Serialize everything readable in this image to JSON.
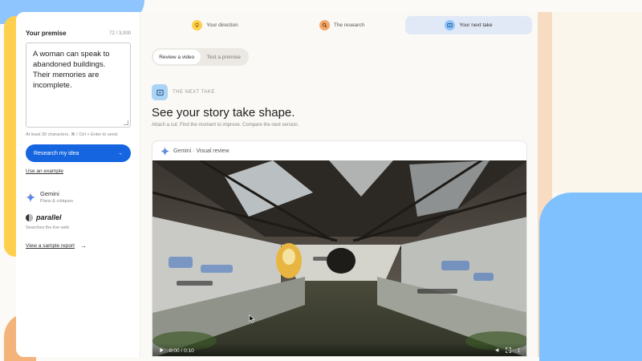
{
  "sidebar": {
    "premise_label": "Your premise",
    "premise_count": "72 / 3,000",
    "premise_text": "A woman can speak to abandoned buildings. Their memories are incomplete.",
    "hint": "At least 30 characters. ⌘ / Ctrl + Enter to send.",
    "research_button": "Research my idea",
    "research_arrow": "→",
    "example_link": "Use an example",
    "gemini_name": "Gemini",
    "gemini_sub": "Plans & critiques",
    "parallel_name": "parallel",
    "parallel_sub": "Searches the live web",
    "sample_link": "View a sample report",
    "sample_arrow": "→"
  },
  "steps": [
    {
      "label": "Your direction",
      "icon": "lightbulb-icon"
    },
    {
      "label": "The research",
      "icon": "search-icon"
    },
    {
      "label": "Your next take",
      "icon": "video-icon"
    }
  ],
  "tabs": [
    "Review a video",
    "Test a premise"
  ],
  "section": {
    "eyebrow": "THE NEXT TAKE",
    "title": "See your story take shape.",
    "subtitle": "Attach a cut. Find the moment to improve. Compare the next version."
  },
  "card": {
    "header": "Gemini · Visual review",
    "time": "0:00 / 0:10"
  },
  "colors": {
    "accent_blue": "#1565e0",
    "yellow": "#ffd04d",
    "orange": "#f4a86a",
    "light_blue": "#8ec5ff"
  }
}
